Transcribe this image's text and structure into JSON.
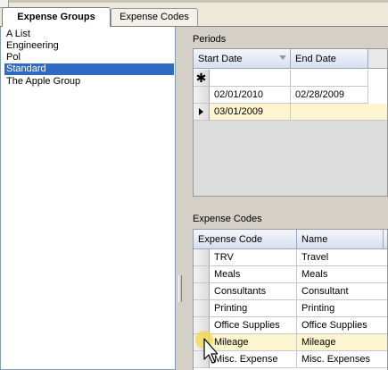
{
  "tabs": [
    {
      "label": "Expense Groups",
      "active": true
    },
    {
      "label": "Expense Codes",
      "active": false
    }
  ],
  "groups": {
    "items": [
      "A List",
      "Engineering",
      "Pol",
      "Standard",
      "The Apple Group"
    ],
    "selected": "Standard"
  },
  "periods": {
    "label": "Periods",
    "columns": [
      "Start Date",
      "End Date"
    ],
    "new_row_symbol": "✱",
    "rows": [
      {
        "start": "02/01/2010",
        "end": "02/28/2009"
      },
      {
        "start": "03/01/2009",
        "end": ""
      }
    ]
  },
  "expense_codes": {
    "label": "Expense Codes",
    "columns": [
      "Expense Code",
      "Name"
    ],
    "rows": [
      {
        "code": "TRV",
        "name": "Travel"
      },
      {
        "code": "Meals",
        "name": "Meals"
      },
      {
        "code": "Consultants",
        "name": "Consultant"
      },
      {
        "code": "Printing",
        "name": "Printing"
      },
      {
        "code": "Office Supplies",
        "name": "Office Supplies"
      },
      {
        "code": "Mileage",
        "name": "Mileage"
      },
      {
        "code": "Misc. Expense",
        "name": "Misc. Expenses"
      }
    ]
  },
  "colors": {
    "selection": "#316ac5",
    "row_highlight": "#fdf5d0",
    "header_gradient_bottom": "#d6dff0"
  }
}
